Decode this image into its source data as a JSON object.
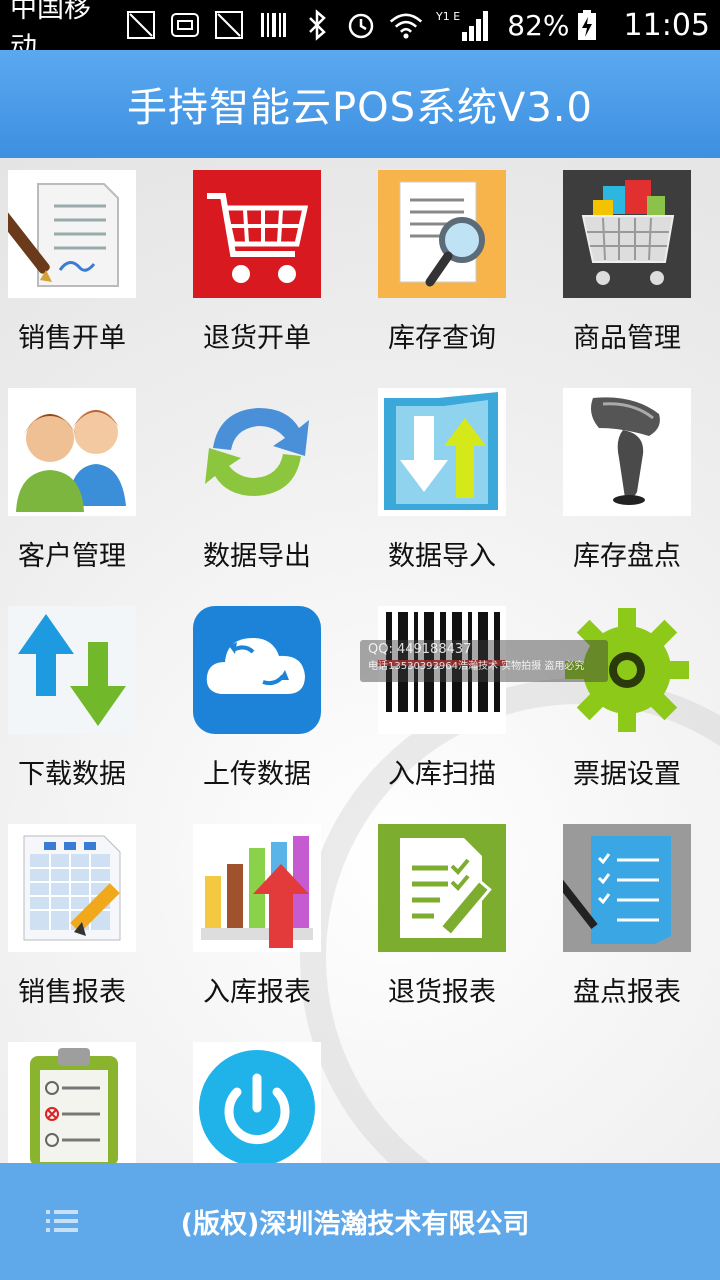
{
  "status_bar": {
    "carrier": "中国移动",
    "signal_label": "1 E",
    "battery_percent": "82%",
    "time": "11:05",
    "icons": [
      "sim-off-icon",
      "mail-icon",
      "sim-off-icon",
      "barcode-icon",
      "bluetooth-icon",
      "alarm-icon",
      "wifi-icon",
      "signal-icon",
      "battery-charging-icon"
    ]
  },
  "header": {
    "title": "手持智能云POS系统V3.0"
  },
  "menu": {
    "items": [
      {
        "label": "销售开单",
        "icon": "sales-invoice-icon"
      },
      {
        "label": "退货开单",
        "icon": "shopping-cart-icon"
      },
      {
        "label": "库存查询",
        "icon": "inventory-search-icon"
      },
      {
        "label": "商品管理",
        "icon": "gift-cart-icon"
      },
      {
        "label": "客户管理",
        "icon": "customers-icon"
      },
      {
        "label": "数据导出",
        "icon": "refresh-arrows-icon"
      },
      {
        "label": "数据导入",
        "icon": "folder-import-icon"
      },
      {
        "label": "库存盘点",
        "icon": "barcode-scanner-icon"
      },
      {
        "label": "下载数据",
        "icon": "up-down-arrows-icon"
      },
      {
        "label": "上传数据",
        "icon": "cloud-upload-icon"
      },
      {
        "label": "入库扫描",
        "icon": "barcode-icon"
      },
      {
        "label": "票据设置",
        "icon": "gear-icon"
      },
      {
        "label": "销售报表",
        "icon": "spreadsheet-pencil-icon"
      },
      {
        "label": "入库报表",
        "icon": "bar-chart-arrow-icon"
      },
      {
        "label": "退货报表",
        "icon": "document-edit-icon"
      },
      {
        "label": "盘点报表",
        "icon": "checklist-pen-icon"
      },
      {
        "label": "",
        "icon": "clipboard-checklist-icon"
      },
      {
        "label": "",
        "icon": "power-icon"
      }
    ]
  },
  "watermark": {
    "qq": "QQ: 449188437",
    "line2": "电话13530393964浩瀚技术  实物拍摄 盗用必究"
  },
  "footer": {
    "menu_icon": "menu-list-icon",
    "copyright": "(版权)深圳浩瀚技术有限公司"
  },
  "colors": {
    "title_bar": "#4a9ce8",
    "footer": "#5fa8ea"
  }
}
